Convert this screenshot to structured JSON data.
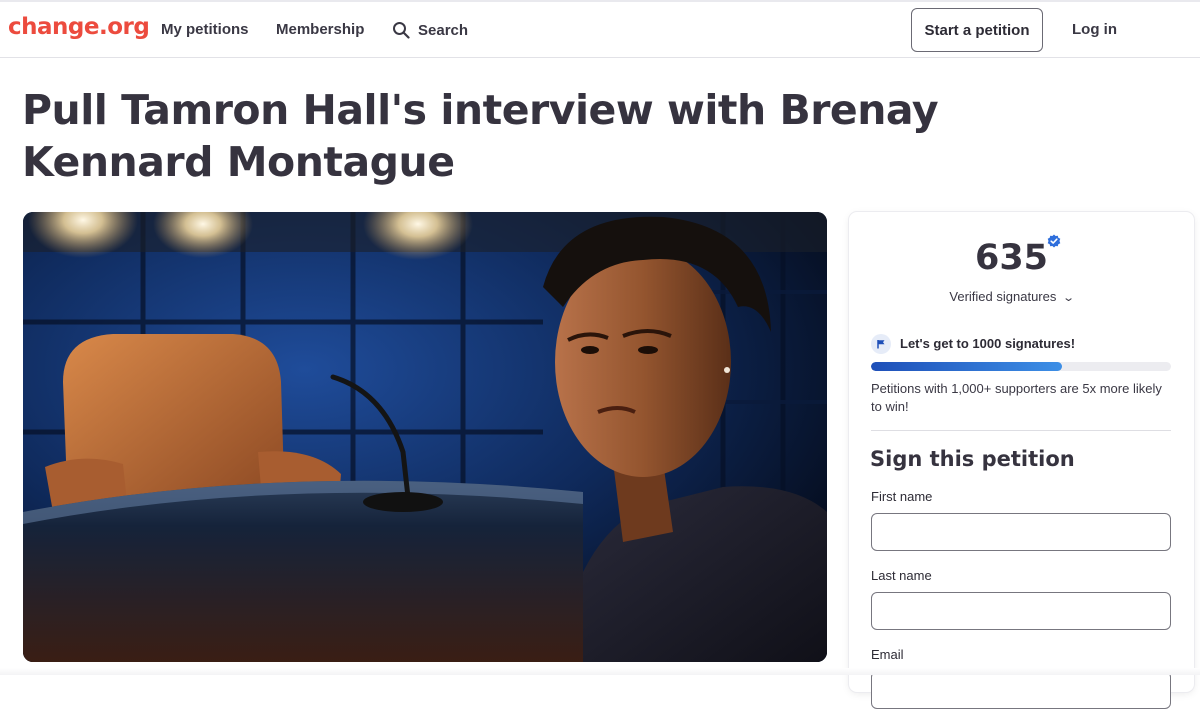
{
  "header": {
    "logo": "change.org",
    "nav": {
      "my_petitions": "My petitions",
      "membership": "Membership",
      "search": "Search"
    },
    "start_petition": "Start a petition",
    "log_in": "Log in"
  },
  "petition": {
    "title": "Pull Tamron Hall's interview with Brenay Kennard Montague"
  },
  "signatures": {
    "count": "635",
    "verified_label": "Verified signatures",
    "goal_text": "Let's get to 1000 signatures!",
    "progress_fraction": 0.635,
    "goal_note": "Petitions with 1,000+ supporters are 5x more likely to win!"
  },
  "sign_form": {
    "title": "Sign this petition",
    "first_name_label": "First name",
    "first_name_value": "",
    "last_name_label": "Last name",
    "last_name_value": "",
    "email_label": "Email",
    "email_value": ""
  },
  "colors": {
    "brand": "#ec4b3e",
    "progress": "#3d8fe6",
    "verified": "#2f6fdc"
  },
  "icons": {
    "search": "search-icon",
    "verified": "verified-check-icon",
    "chevron": "chevron-down-icon",
    "flag": "flag-icon"
  }
}
